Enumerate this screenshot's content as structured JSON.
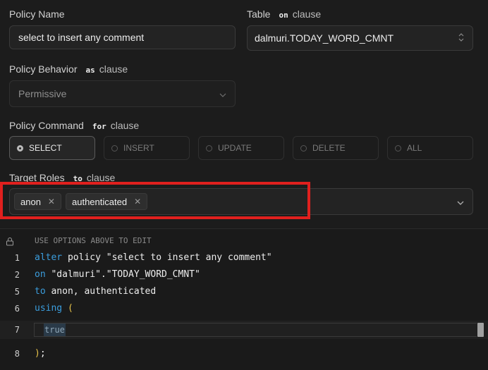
{
  "policy_name": {
    "label": "Policy Name",
    "value": "select to insert any comment"
  },
  "table": {
    "label": "Table",
    "keyword": "on",
    "clause": "clause",
    "value": "dalmuri.TODAY_WORD_CMNT"
  },
  "behavior": {
    "label": "Policy Behavior",
    "keyword": "as",
    "clause": "clause",
    "value": "Permissive"
  },
  "command": {
    "label": "Policy Command",
    "keyword": "for",
    "clause": "clause",
    "options": [
      "SELECT",
      "INSERT",
      "UPDATE",
      "DELETE",
      "ALL"
    ],
    "selected": "SELECT"
  },
  "roles": {
    "label": "Target Roles",
    "keyword": "to",
    "clause": "clause",
    "chips": [
      "anon",
      "authenticated"
    ]
  },
  "editor": {
    "header": "USE OPTIONS ABOVE TO EDIT",
    "lines": [
      {
        "num": "1",
        "kw": "alter",
        "text": " policy \"select to insert any comment\""
      },
      {
        "num": "2",
        "kw": "on",
        "text": " \"dalmuri\".\"TODAY_WORD_CMNT\""
      },
      {
        "num": "5",
        "kw": "to",
        "text": " anon, authenticated"
      },
      {
        "num": "6",
        "kw": "using",
        "text": " ",
        "paren": "("
      },
      {
        "num": "7",
        "value": "true"
      },
      {
        "num": "8",
        "paren": ")",
        "text": ";"
      }
    ]
  }
}
